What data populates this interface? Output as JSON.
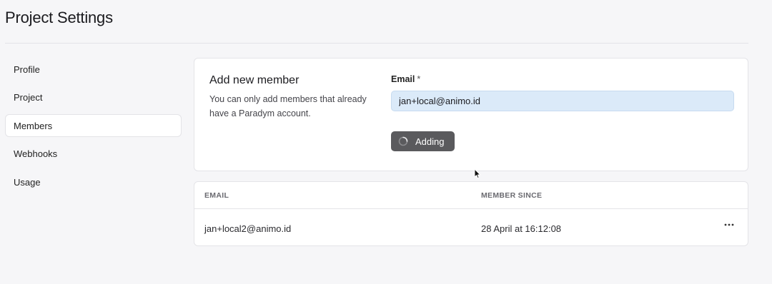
{
  "page": {
    "title": "Project Settings"
  },
  "sidebar": {
    "items": [
      {
        "label": "Profile",
        "active": false
      },
      {
        "label": "Project",
        "active": false
      },
      {
        "label": "Members",
        "active": true
      },
      {
        "label": "Webhooks",
        "active": false
      },
      {
        "label": "Usage",
        "active": false
      }
    ]
  },
  "add_member": {
    "title": "Add new member",
    "description": "You can only add members that already have a Paradym account.",
    "email_label": "Email",
    "required_mark": "*",
    "email_value": "jan+local@animo.id",
    "button_label": "Adding",
    "button_icon": "spinner-icon"
  },
  "members_table": {
    "columns": [
      "EMAIL",
      "MEMBER SINCE"
    ],
    "rows": [
      {
        "email": "jan+local2@animo.id",
        "member_since": "28 April at 16:12:08",
        "actions_icon": "more-horizontal-icon"
      }
    ]
  },
  "colors": {
    "background": "#f6f6f8",
    "card": "#ffffff",
    "input_fill": "#dbeaf9",
    "button": "#5a5a5d"
  }
}
